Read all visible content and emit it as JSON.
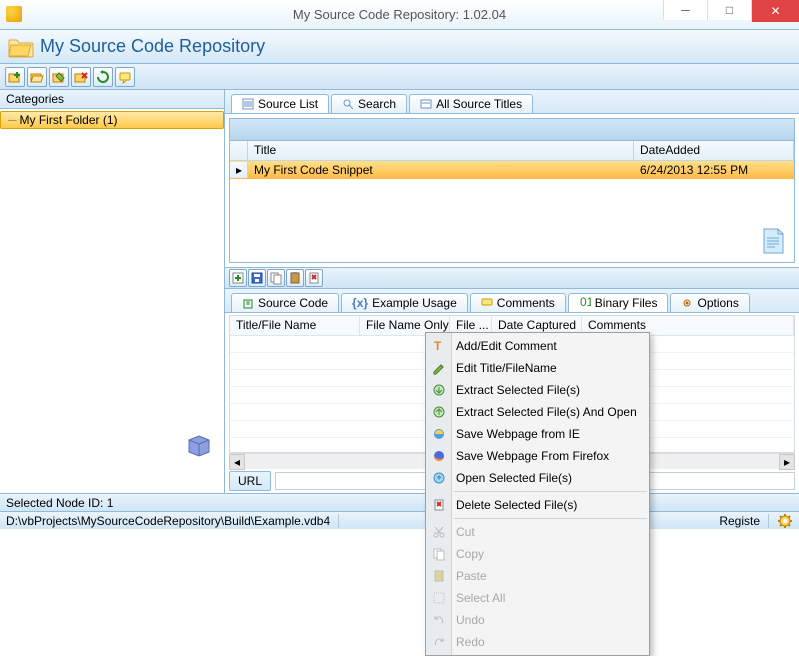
{
  "window": {
    "title": "My Source Code Repository: 1.02.04"
  },
  "app": {
    "heading": "My Source Code Repository"
  },
  "sidebar": {
    "header": "Categories",
    "items": [
      {
        "label": "My First Folder (1)"
      }
    ]
  },
  "tabs_top": [
    {
      "label": "Source List"
    },
    {
      "label": "Search"
    },
    {
      "label": "All Source Titles"
    }
  ],
  "grid": {
    "columns": {
      "title": "Title",
      "date": "DateAdded"
    },
    "rows": [
      {
        "title": "My First Code Snippet",
        "date": "6/24/2013 12:55 PM"
      }
    ]
  },
  "tabs_bottom": [
    {
      "label": "Source Code"
    },
    {
      "label": "Example Usage"
    },
    {
      "label": "Comments"
    },
    {
      "label": "Binary Files"
    },
    {
      "label": "Options"
    }
  ],
  "detail": {
    "columns": {
      "title": "Title/File Name",
      "fileonly": "File Name Only",
      "filex": "File ...",
      "captured": "Date Captured",
      "comments": "Comments"
    },
    "url_label": "URL"
  },
  "context_menu": [
    {
      "label": "Add/Edit Comment",
      "icon": "text-icon"
    },
    {
      "label": "Edit Title/FileName",
      "icon": "pencil-icon"
    },
    {
      "label": "Extract Selected File(s)",
      "icon": "extract-icon"
    },
    {
      "label": "Extract Selected File(s) And Open",
      "icon": "extract-open-icon"
    },
    {
      "label": "Save Webpage from IE",
      "icon": "ie-icon"
    },
    {
      "label": "Save Webpage From Firefox",
      "icon": "firefox-icon"
    },
    {
      "label": "Open Selected File(s)",
      "icon": "open-icon"
    },
    {
      "sep": true
    },
    {
      "label": "Delete Selected File(s)",
      "icon": "delete-icon"
    },
    {
      "sep": true
    },
    {
      "label": "Cut",
      "icon": "cut-icon",
      "disabled": true
    },
    {
      "label": "Copy",
      "icon": "copy-icon",
      "disabled": true
    },
    {
      "label": "Paste",
      "icon": "paste-icon",
      "disabled": true
    },
    {
      "label": "Select All",
      "icon": "selectall-icon",
      "disabled": true
    },
    {
      "label": "Undo",
      "icon": "undo-icon",
      "disabled": true
    },
    {
      "label": "Redo",
      "icon": "redo-icon",
      "disabled": true
    }
  ],
  "status": {
    "node": "Selected Node ID: 1",
    "path": "D:\\vbProjects\\MySourceCodeRepository\\Build\\Example.vdb4",
    "register": "Registe"
  }
}
